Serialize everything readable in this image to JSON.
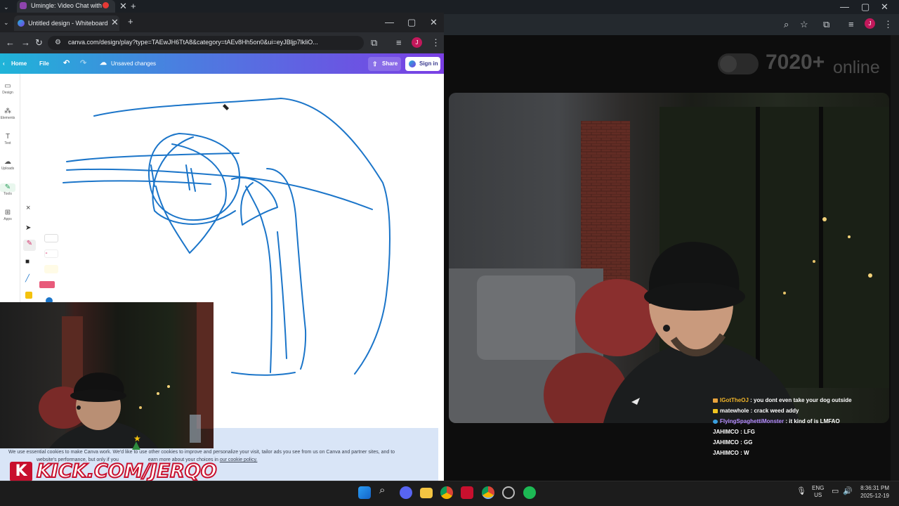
{
  "left_browser": {
    "tab1_title": "Umingle: Video Chat with S",
    "tab2_title": "Untitled design - Whiteboard",
    "url": "canva.com/design/play?type=TAEwJH6TtA8&category=tAEv8Hh5on0&ui=eyJBljp7lkliO...",
    "profile_initial": "J"
  },
  "canva": {
    "home_label": "Home",
    "file_label": "File",
    "status": "Unsaved changes",
    "share_label": "Share",
    "signin_label": "Sign in",
    "rail": [
      {
        "label": "Design",
        "icon": "design-icon"
      },
      {
        "label": "Elements",
        "icon": "elements-icon"
      },
      {
        "label": "Text",
        "icon": "text-icon"
      },
      {
        "label": "Uploads",
        "icon": "uploads-icon"
      },
      {
        "label": "Tools",
        "icon": "tools-icon"
      },
      {
        "label": "Apps",
        "icon": "apps-icon"
      }
    ],
    "close_glyph": "×",
    "pen_color": "#1b75c9",
    "cookie_text_1": "We use essential cookies to make Canva work. We'd like to use other cookies to improve and personalize your visit, tailor ads you see from us on Canva and partner sites, and to",
    "cookie_text_2": "website's performance, but only if you",
    "cookie_text_3": "earn more about your choices in",
    "cookie_link": "our cookie policy."
  },
  "right_browser": {
    "profile_initial": "J",
    "online_count": "7020+",
    "online_label": "online"
  },
  "chat": [
    {
      "user": "IGotTheOJ",
      "message": "you dont even take your dog outside",
      "user_color": "#f0b429",
      "badge_color": "#e8a33d"
    },
    {
      "user": "matewhole",
      "message": "crack weed addy",
      "user_color": "#ffffff",
      "badge_color": "#f0c420"
    },
    {
      "user": "FlyingSpaghettiMonster",
      "message": "it kind of is LMFAO",
      "user_color": "#b58bff",
      "badge_color": "#3aa0e0"
    },
    {
      "user": "JAHIMCO",
      "message": "LFG",
      "user_color": "#ffffff",
      "badge_color": ""
    },
    {
      "user": "JAHIMCO",
      "message": "GG",
      "user_color": "#ffffff",
      "badge_color": ""
    },
    {
      "user": "JAHIMCO",
      "message": "W",
      "user_color": "#ffffff",
      "badge_color": ""
    }
  ],
  "overlay": {
    "kick_text": "KICK.COM/JERQO",
    "kick_color": "#53fc18"
  },
  "taskbar": {
    "lang_line1": "ENG",
    "lang_line2": "US",
    "time": "8:36:31 PM",
    "date": "2025-12-19"
  }
}
